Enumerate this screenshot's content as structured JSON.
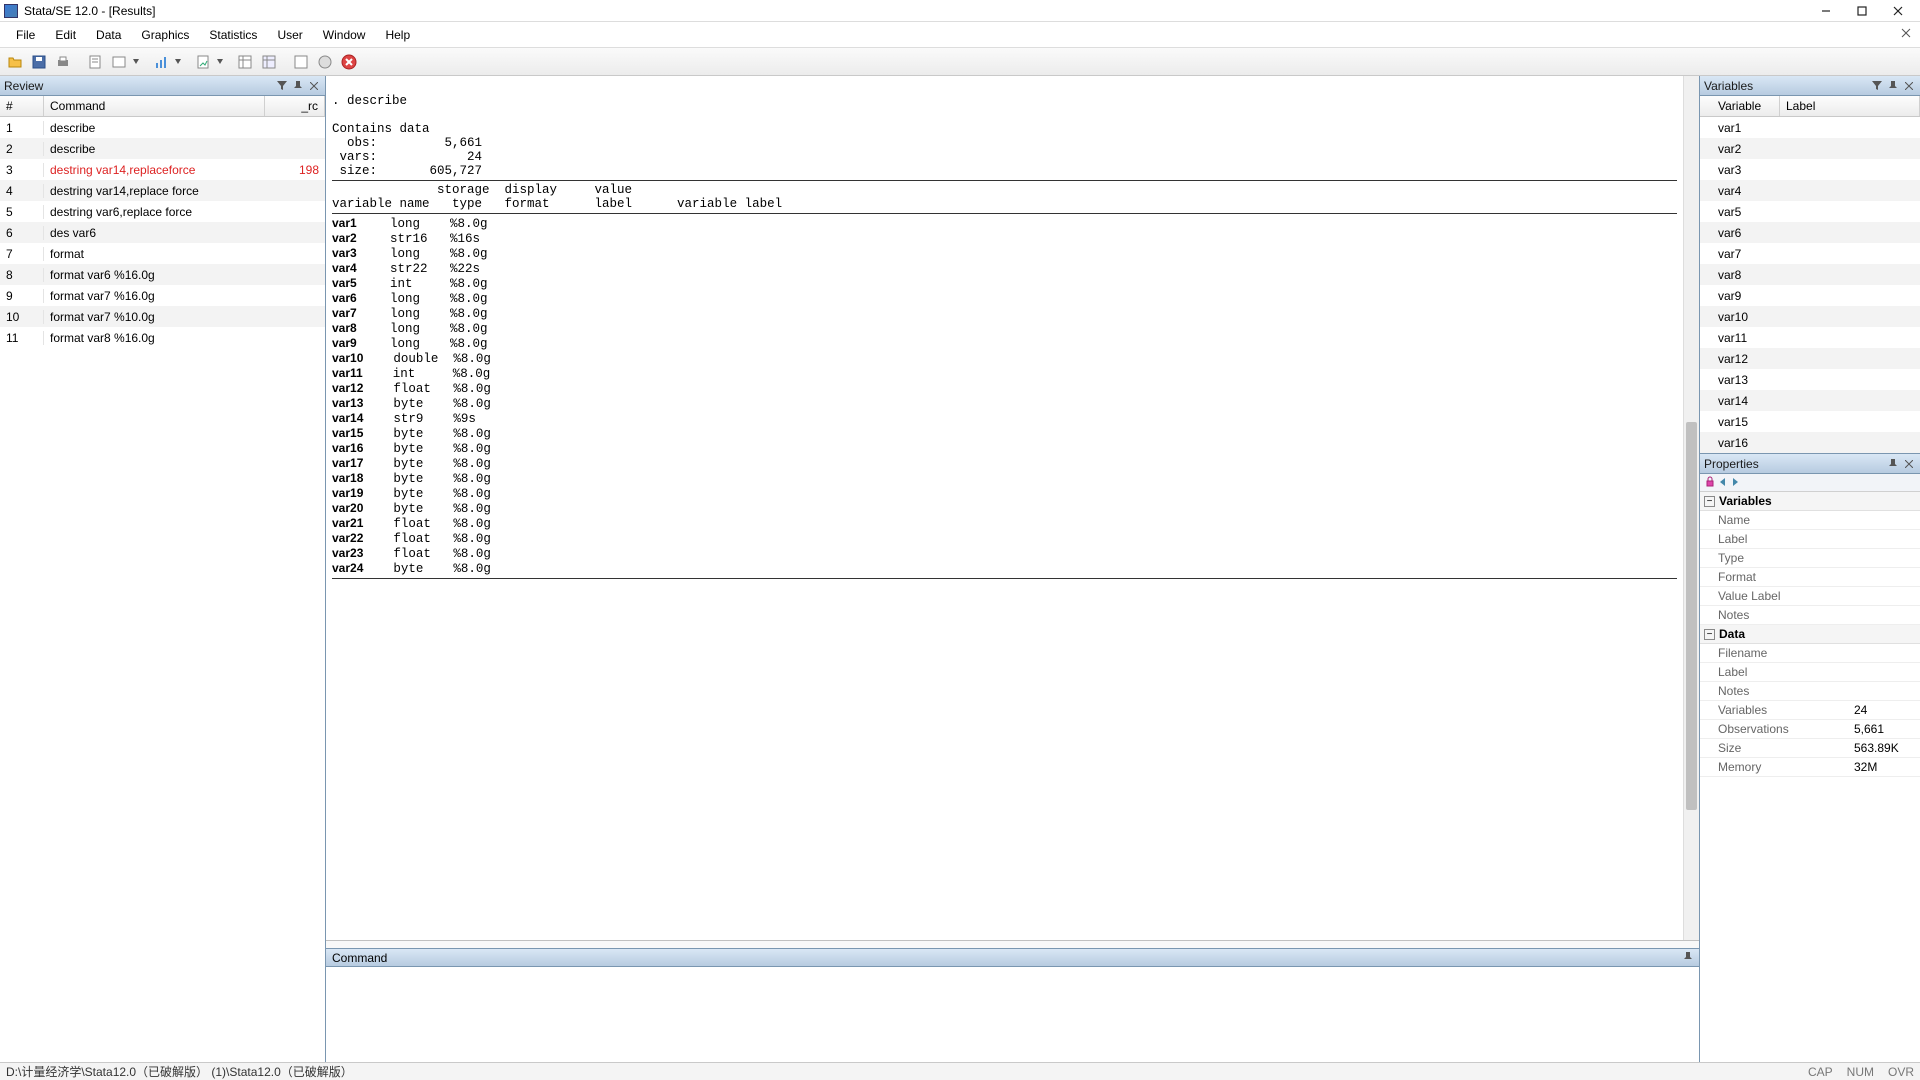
{
  "title": "Stata/SE 12.0 - [Results]",
  "menu": [
    "File",
    "Edit",
    "Data",
    "Graphics",
    "Statistics",
    "User",
    "Window",
    "Help"
  ],
  "review": {
    "title": "Review",
    "cols": {
      "num": "#",
      "cmd": "Command",
      "rc": "_rc"
    },
    "rows": [
      {
        "n": "1",
        "cmd": "describe",
        "rc": ""
      },
      {
        "n": "2",
        "cmd": "describe",
        "rc": ""
      },
      {
        "n": "3",
        "cmd": "destring var14,replaceforce",
        "rc": "198",
        "err": true
      },
      {
        "n": "4",
        "cmd": "destring var14,replace force",
        "rc": ""
      },
      {
        "n": "5",
        "cmd": "destring var6,replace force",
        "rc": ""
      },
      {
        "n": "6",
        "cmd": "des var6",
        "rc": ""
      },
      {
        "n": "7",
        "cmd": "format",
        "rc": ""
      },
      {
        "n": "8",
        "cmd": "format var6 %16.0g",
        "rc": ""
      },
      {
        "n": "9",
        "cmd": "format var7 %16.0g",
        "rc": ""
      },
      {
        "n": "10",
        "cmd": "format var7 %10.0g",
        "rc": ""
      },
      {
        "n": "11",
        "cmd": "format var8 %16.0g",
        "rc": ""
      }
    ]
  },
  "results": {
    "cmdline": ". describe",
    "header_line": "Contains data",
    "obs_lbl": "  obs:",
    "obs_val": "         5,661",
    "vars_lbl": " vars:",
    "vars_val": "            24",
    "size_lbl": " size:",
    "size_val": "       605,727",
    "colhdr1": "              storage  display     value",
    "colhdr2": "variable name   type   format      label      variable label",
    "vars": [
      {
        "name": "var1",
        "type": "long",
        "fmt": "%8.0g"
      },
      {
        "name": "var2",
        "type": "str16",
        "fmt": "%16s"
      },
      {
        "name": "var3",
        "type": "long",
        "fmt": "%8.0g"
      },
      {
        "name": "var4",
        "type": "str22",
        "fmt": "%22s"
      },
      {
        "name": "var5",
        "type": "int",
        "fmt": "%8.0g"
      },
      {
        "name": "var6",
        "type": "long",
        "fmt": "%8.0g"
      },
      {
        "name": "var7",
        "type": "long",
        "fmt": "%8.0g"
      },
      {
        "name": "var8",
        "type": "long",
        "fmt": "%8.0g"
      },
      {
        "name": "var9",
        "type": "long",
        "fmt": "%8.0g"
      },
      {
        "name": "var10",
        "type": "double",
        "fmt": "%8.0g"
      },
      {
        "name": "var11",
        "type": "int",
        "fmt": "%8.0g"
      },
      {
        "name": "var12",
        "type": "float",
        "fmt": "%8.0g"
      },
      {
        "name": "var13",
        "type": "byte",
        "fmt": "%8.0g"
      },
      {
        "name": "var14",
        "type": "str9",
        "fmt": "%9s"
      },
      {
        "name": "var15",
        "type": "byte",
        "fmt": "%8.0g"
      },
      {
        "name": "var16",
        "type": "byte",
        "fmt": "%8.0g"
      },
      {
        "name": "var17",
        "type": "byte",
        "fmt": "%8.0g"
      },
      {
        "name": "var18",
        "type": "byte",
        "fmt": "%8.0g"
      },
      {
        "name": "var19",
        "type": "byte",
        "fmt": "%8.0g"
      },
      {
        "name": "var20",
        "type": "byte",
        "fmt": "%8.0g"
      },
      {
        "name": "var21",
        "type": "float",
        "fmt": "%8.0g"
      },
      {
        "name": "var22",
        "type": "float",
        "fmt": "%8.0g"
      },
      {
        "name": "var23",
        "type": "float",
        "fmt": "%8.0g"
      },
      {
        "name": "var24",
        "type": "byte",
        "fmt": "%8.0g"
      }
    ]
  },
  "cmdpane": {
    "title": "Command"
  },
  "varpanel": {
    "title": "Variables",
    "cols": {
      "var": "Variable",
      "label": "Label"
    },
    "list": [
      "var1",
      "var2",
      "var3",
      "var4",
      "var5",
      "var6",
      "var7",
      "var8",
      "var9",
      "var10",
      "var11",
      "var12",
      "var13",
      "var14",
      "var15",
      "var16"
    ]
  },
  "props": {
    "title": "Properties",
    "vars_group": "Variables",
    "var_fields": [
      "Name",
      "Label",
      "Type",
      "Format",
      "Value Label",
      "Notes"
    ],
    "data_group": "Data",
    "data_rows": [
      {
        "k": "Filename",
        "v": ""
      },
      {
        "k": "Label",
        "v": ""
      },
      {
        "k": "Notes",
        "v": ""
      },
      {
        "k": "Variables",
        "v": "24"
      },
      {
        "k": "Observations",
        "v": "5,661"
      },
      {
        "k": "Size",
        "v": "563.89K"
      },
      {
        "k": "Memory",
        "v": "32M"
      }
    ]
  },
  "status": {
    "path": "D:\\计量经济学\\Stata12.0（已破解版） (1)\\Stata12.0（已破解版）",
    "cap": "CAP",
    "num": "NUM",
    "ovr": "OVR"
  }
}
